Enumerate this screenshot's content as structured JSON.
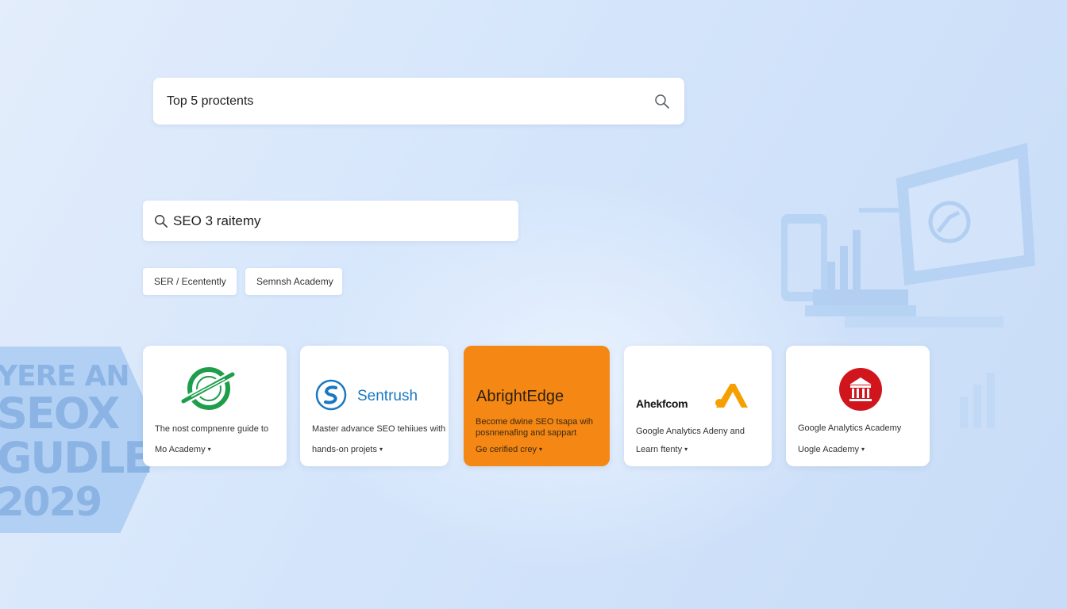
{
  "colors": {
    "background": "#d4e5fb",
    "card": "#ffffff",
    "accent_orange": "#f58714",
    "sentrush_blue": "#1a78c2",
    "moz_green": "#1e9e4a",
    "red_badge": "#d0161c",
    "ahrefs_orange": "#f5a000"
  },
  "banner": {
    "line1": "YERE AN",
    "line2": "SEOX",
    "line3": "GUDLE",
    "line4": "2029"
  },
  "search_main": {
    "value": "Top 5 proctents",
    "icon": "search-icon"
  },
  "search_sub": {
    "value": "SEO 3 raitemy",
    "icon": "search-icon"
  },
  "chips": [
    {
      "label": "SER / Ecentently"
    },
    {
      "label": "Semnsh Academy"
    }
  ],
  "cards": [
    {
      "icon": "green-ring-logo-icon",
      "line1": "The nost compnenre guide to",
      "line2": "Mo Academy",
      "caret": "▾"
    },
    {
      "icon": "sentrush-s-logo-icon",
      "brand": "Sentrush",
      "line1": "Master advance SEO tehiiues with",
      "line2": "hands-on projets",
      "caret": "▾"
    },
    {
      "brand": "AbrightEdge",
      "line1": "Become dwine SEO tsapa wih",
      "line2": "posnnenafing and sappart",
      "line3": "Ge cerified crey",
      "caret": "▾"
    },
    {
      "icon": "ahrefs-chevron-icon",
      "brand": "Ahekfcom",
      "line1": "Google Analytics Adeny and",
      "line2": "Learn ftenty",
      "caret": "▾"
    },
    {
      "icon": "institution-badge-icon",
      "line1": "Google Analytics Academy",
      "line2": "Uogle Academy",
      "caret": "▾"
    }
  ]
}
